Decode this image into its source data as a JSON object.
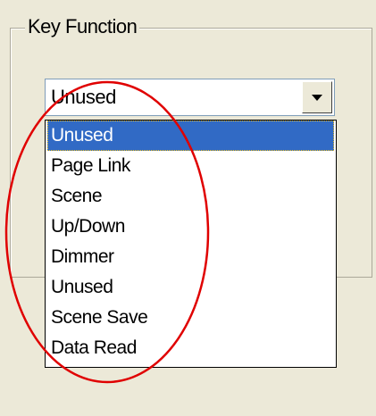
{
  "group": {
    "title": "Key Function"
  },
  "combo": {
    "selected_value": "Unused",
    "button_icon": "chevron-down-icon"
  },
  "dropdown": {
    "items": [
      {
        "label": "Unused",
        "selected": true
      },
      {
        "label": "Page Link",
        "selected": false
      },
      {
        "label": "Scene",
        "selected": false
      },
      {
        "label": "Up/Down",
        "selected": false
      },
      {
        "label": "Dimmer",
        "selected": false
      },
      {
        "label": "Unused",
        "selected": false
      },
      {
        "label": "Scene Save",
        "selected": false
      },
      {
        "label": "Data Read",
        "selected": false
      }
    ]
  },
  "colors": {
    "window_bg": "#ece9d8",
    "selection_bg": "#316ac5",
    "annotation_circle": "#e00000"
  }
}
